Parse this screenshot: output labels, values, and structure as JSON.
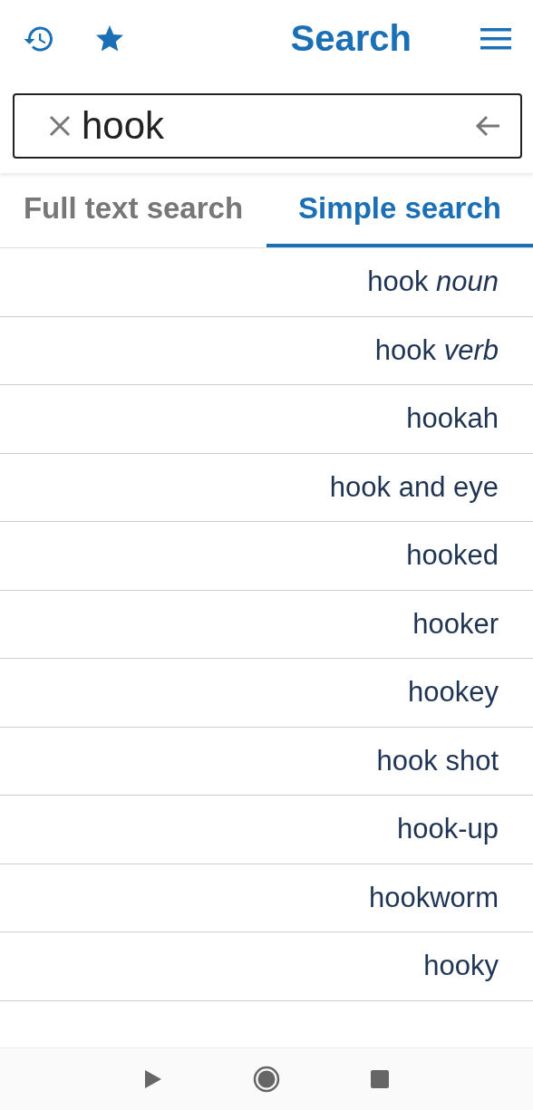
{
  "header": {
    "title": "Search"
  },
  "search": {
    "value": "hook"
  },
  "tabs": [
    {
      "label": "Full text search",
      "selected": false
    },
    {
      "label": "Simple search",
      "selected": true
    }
  ],
  "results": [
    "hook *noun*",
    "hook *verb*",
    "hookah",
    "hook and eye",
    "hooked",
    "hooker",
    "hookey",
    "hook shot",
    "hook-up",
    "hookworm",
    "hooky"
  ]
}
